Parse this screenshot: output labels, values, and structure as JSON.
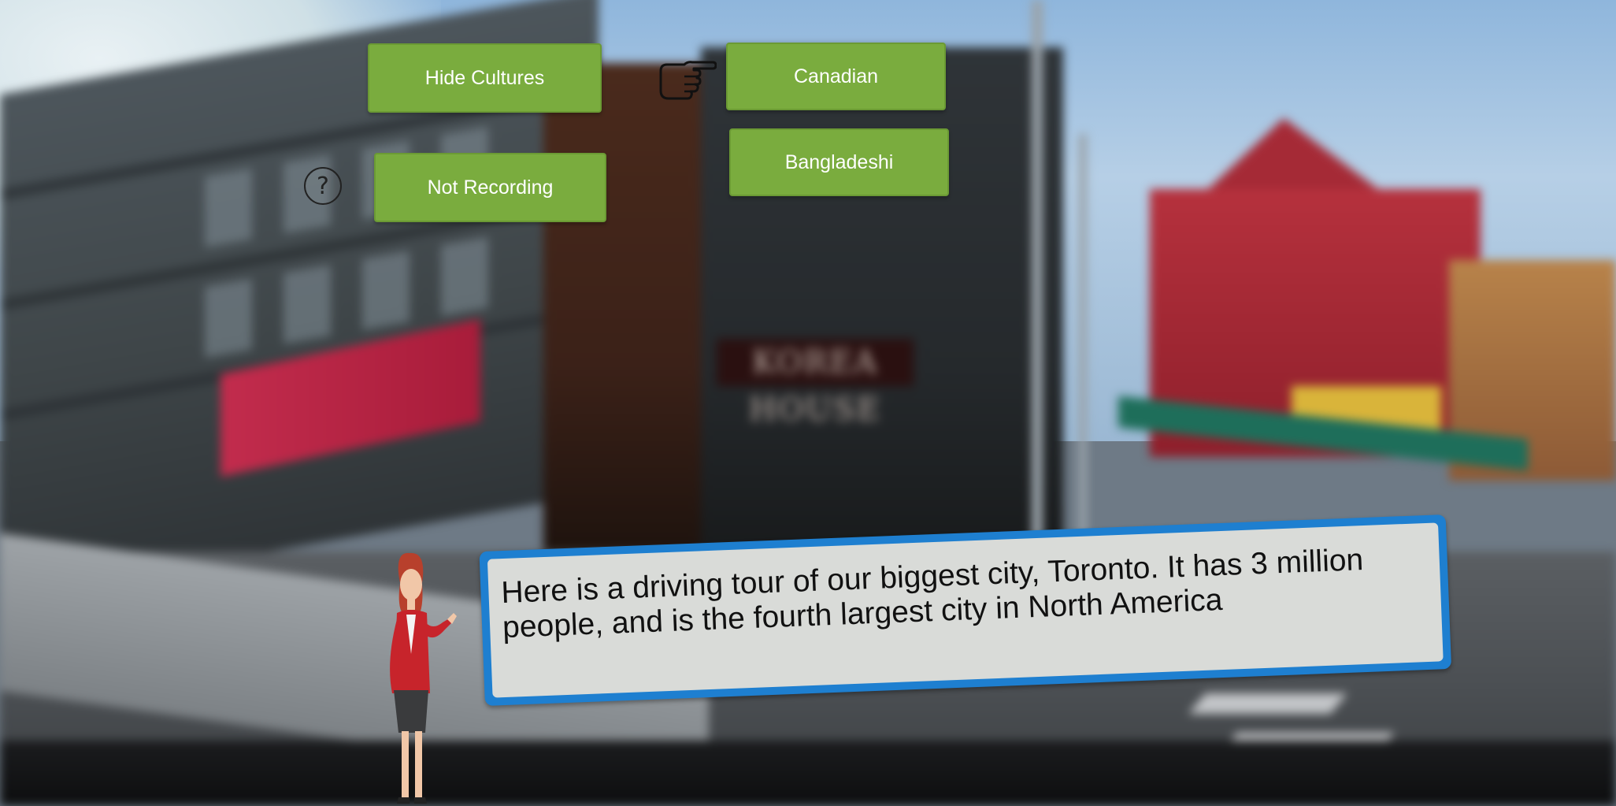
{
  "buttons": {
    "hide_cultures": "Hide Cultures",
    "not_recording": "Not Recording",
    "canadian": "Canadian",
    "bangladeshi": "Bangladeshi"
  },
  "help": {
    "glyph": "?"
  },
  "icons": {
    "help": "help-circle-icon",
    "pointer": "hand-pointer-icon"
  },
  "scene": {
    "storefront_sign": "KOREA HOUSE"
  },
  "speech": {
    "text": "Here is a driving tour of our biggest city, Toronto. It has 3 million people, and is the fourth largest city in North America"
  },
  "colors": {
    "button": "#7aac3e",
    "speech_border": "#1e7fd0",
    "speech_bg": "#d9dbd8"
  }
}
